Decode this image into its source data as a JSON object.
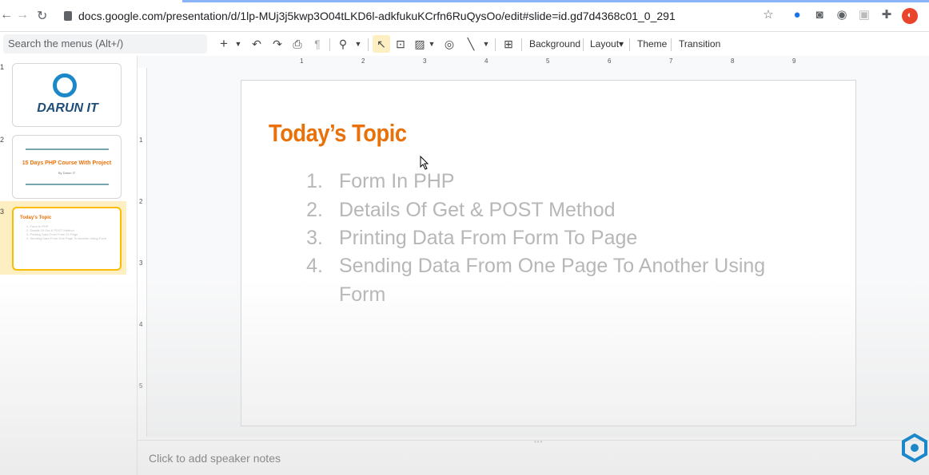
{
  "browser": {
    "url": "docs.google.com/presentation/d/1lp-MUj3j5kwp3O04tLKD6l-adkfukuKCrfn6RuQysOo/edit#slide=id.gd7d4368c01_0_291"
  },
  "toolbar": {
    "search_placeholder": "Search the menus (Alt+/)",
    "background_label": "Background",
    "layout_label": "Layout▾",
    "theme_label": "Theme",
    "transition_label": "Transition"
  },
  "ruler": {
    "h_ticks": [
      "1",
      "2",
      "3",
      "4",
      "5",
      "6",
      "7",
      "8",
      "9"
    ],
    "v_ticks": [
      "1",
      "2",
      "3",
      "4",
      "5"
    ]
  },
  "filmstrip": {
    "slides": [
      {
        "number": "1",
        "brand": "DARUN IT"
      },
      {
        "number": "2",
        "title": "15 Days PHP Course With Project",
        "subtitle": "By Darun IT"
      },
      {
        "number": "3",
        "title": "Today's Topic",
        "lines": [
          "1. Form In PHP",
          "2. Details Of Get & POST Method",
          "3. Printing Data From Form To Page",
          "4. Sending Data From One Page To Another Using Form"
        ]
      }
    ]
  },
  "slide": {
    "title": "Today’s Topic",
    "items": [
      {
        "n": "1.",
        "text": "Form In PHP"
      },
      {
        "n": "2.",
        "text": "Details Of Get & POST Method"
      },
      {
        "n": "3.",
        "text": "Printing Data From Form To Page"
      },
      {
        "n": "4.",
        "text": "Sending Data From One Page To Another Using"
      },
      {
        "n": "",
        "text": "Form"
      }
    ]
  },
  "notes": {
    "placeholder": "Click to add speaker notes"
  },
  "colors": {
    "accent": "#e8710a",
    "selection": "#fbbc04",
    "item_text": "#b7b7b7"
  }
}
